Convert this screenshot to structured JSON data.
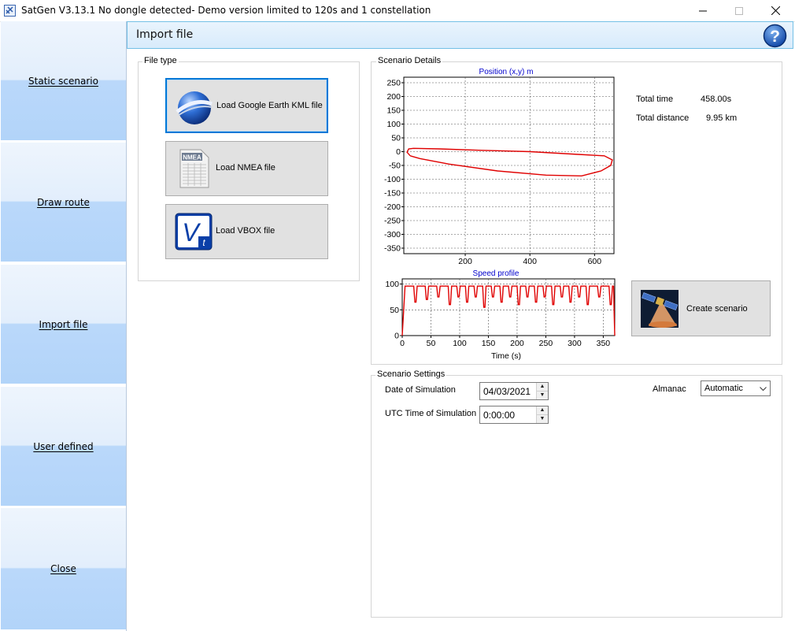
{
  "window": {
    "title": "SatGen V3.13.1 No dongle detected- Demo version limited to 120s and 1 constellation"
  },
  "nav": {
    "items": [
      {
        "label": "Static scenario"
      },
      {
        "label": "Draw route"
      },
      {
        "label": "Import file"
      },
      {
        "label": "User defined"
      },
      {
        "label": "Close"
      }
    ]
  },
  "header": {
    "title": "Import file"
  },
  "file_type": {
    "group_label": "File type",
    "buttons": [
      {
        "label": "Load Google Earth KML file",
        "icon": "google-earth-icon",
        "selected": true
      },
      {
        "label": "Load NMEA file",
        "icon": "nmea-icon",
        "selected": false
      },
      {
        "label": "Load VBOX file",
        "icon": "vbox-icon",
        "selected": false
      }
    ],
    "nmea_icon_text": "NMEA",
    "vbox_icon_text": "V",
    "vbox_icon_sub": "t"
  },
  "details": {
    "group_label": "Scenario Details",
    "total_time_label": "Total time",
    "total_time_value": "458.00s",
    "total_distance_label": "Total distance",
    "total_distance_value": "9.95 km",
    "create_button": "Create scenario"
  },
  "settings": {
    "group_label": "Scenario Settings",
    "date_label": "Date of Simulation",
    "date_value": "04/03/2021",
    "time_label": "UTC Time of Simulation",
    "time_value": "0:00:00",
    "almanac_label": "Almanac",
    "almanac_value": "Automatic"
  },
  "chart_data": [
    {
      "type": "line",
      "title": "Position (x,y) m",
      "xlabel": "",
      "ylabel": "",
      "xlim": [
        10,
        660
      ],
      "ylim": [
        -370,
        270
      ],
      "xticks": [
        200,
        400,
        600
      ],
      "yticks": [
        250,
        200,
        150,
        100,
        50,
        0,
        -50,
        -100,
        -150,
        -200,
        -250,
        -300,
        -350
      ],
      "grid": true,
      "series": [
        {
          "color": "#e00000",
          "x": [
            30,
            20,
            25,
            40,
            120,
            250,
            400,
            550,
            630,
            655,
            650,
            620,
            560,
            450,
            300,
            150,
            60,
            30
          ],
          "y": [
            -15,
            -2,
            10,
            12,
            10,
            5,
            0,
            -10,
            -15,
            -30,
            -50,
            -70,
            -88,
            -85,
            -70,
            -45,
            -25,
            -15
          ]
        }
      ]
    },
    {
      "type": "line",
      "title": "Speed profile",
      "xlabel": "Time (s)",
      "ylabel": "",
      "xlim": [
        0,
        370
      ],
      "ylim": [
        0,
        110
      ],
      "xticks": [
        0,
        50,
        100,
        150,
        200,
        250,
        300,
        350
      ],
      "yticks": [
        100,
        50,
        0
      ],
      "grid": true,
      "series": [
        {
          "color": "#e00000",
          "x": [
            0,
            5,
            15,
            20,
            22,
            24,
            26,
            40,
            42,
            44,
            46,
            60,
            62,
            64,
            66,
            80,
            82,
            84,
            86,
            95,
            97,
            99,
            101,
            110,
            112,
            114,
            116,
            125,
            127,
            129,
            131,
            140,
            142,
            144,
            146,
            155,
            157,
            159,
            161,
            170,
            172,
            174,
            176,
            185,
            187,
            189,
            191,
            200,
            202,
            204,
            206,
            215,
            217,
            219,
            221,
            230,
            232,
            234,
            236,
            245,
            247,
            249,
            251,
            260,
            262,
            264,
            266,
            275,
            277,
            279,
            281,
            290,
            292,
            294,
            296,
            305,
            307,
            309,
            311,
            320,
            322,
            324,
            326,
            340,
            342,
            344,
            346,
            360,
            362,
            364,
            366,
            368,
            369,
            370
          ],
          "y": [
            0,
            96,
            96,
            96,
            65,
            65,
            96,
            96,
            70,
            70,
            96,
            96,
            75,
            75,
            96,
            96,
            60,
            60,
            96,
            96,
            75,
            75,
            96,
            96,
            65,
            65,
            96,
            96,
            75,
            75,
            96,
            96,
            55,
            55,
            96,
            96,
            75,
            75,
            96,
            96,
            65,
            65,
            96,
            96,
            75,
            75,
            96,
            96,
            60,
            60,
            96,
            96,
            75,
            75,
            96,
            96,
            65,
            65,
            96,
            96,
            75,
            75,
            96,
            96,
            60,
            60,
            96,
            96,
            75,
            75,
            96,
            96,
            65,
            65,
            96,
            96,
            75,
            75,
            96,
            96,
            60,
            60,
            96,
            96,
            75,
            75,
            96,
            96,
            60,
            60,
            96,
            96,
            40,
            0
          ]
        }
      ]
    }
  ],
  "colors": {
    "nav_gradient_top": "#eef5fd",
    "nav_gradient_bottom": "#b2d4f9",
    "header_border": "#74c0e6",
    "chart_line": "#e00000",
    "chart_title": "#0000cc",
    "selected_border": "#0078d7"
  }
}
